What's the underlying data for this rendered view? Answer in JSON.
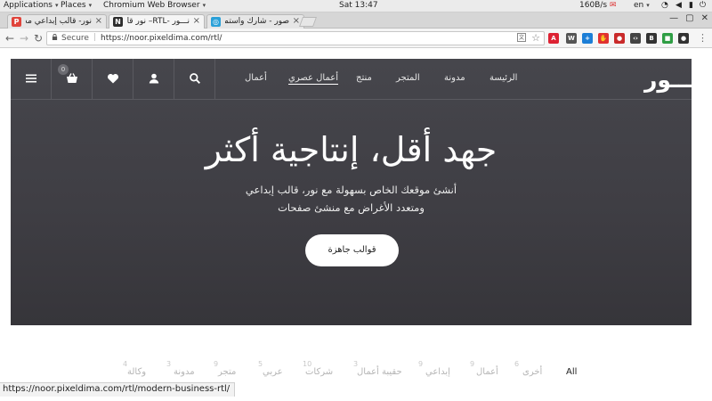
{
  "os": {
    "applications": "Applications",
    "places": "Places",
    "browser": "Chromium Web Browser",
    "clock": "Sat 13:47",
    "netspeed": "160B/s",
    "lang": "en"
  },
  "tabs": [
    {
      "title": "نور- قالب إبداعي مد",
      "favicon_letter": "P",
      "favicon_color": "#e0443b"
    },
    {
      "title": "نـــور -RTL– نور قا",
      "favicon_letter": "N",
      "favicon_color": "#2d2d2d"
    },
    {
      "title": "صور - شارك واستما",
      "favicon_letter": "",
      "favicon_color": "#2aa0d8"
    }
  ],
  "address": {
    "secure_label": "Secure",
    "url": "https://noor.pixeldima.com/rtl/"
  },
  "site": {
    "logo": "نـــور",
    "menu": [
      {
        "label": "الرئيسة"
      },
      {
        "label": "مدونة"
      },
      {
        "label": "المتجر"
      },
      {
        "label": "منتج"
      },
      {
        "label": "أعمال عصري"
      },
      {
        "label": "أعمال"
      }
    ],
    "cart_count": "0",
    "headline": "جهد أقل، إنتاجية أكثر",
    "sub1": "أنشئ موقعك الخاص بسهولة مع نور، قالب إبداعي",
    "sub2": "ومتعدد الأغراض مع منشئ صفحات",
    "cta": "قوالب جاهزة",
    "accent_color": "#3f3e44"
  },
  "filters": [
    {
      "label": "All",
      "count": ""
    },
    {
      "label": "أخرى",
      "count": "6"
    },
    {
      "label": "أعمال",
      "count": "9"
    },
    {
      "label": "إبداعي",
      "count": "9"
    },
    {
      "label": "حقيبة أعمال",
      "count": "3"
    },
    {
      "label": "شركات",
      "count": "10"
    },
    {
      "label": "عربي",
      "count": "5"
    },
    {
      "label": "متجر",
      "count": "9"
    },
    {
      "label": "مدونة",
      "count": "3"
    },
    {
      "label": "وكالة",
      "count": "4"
    }
  ],
  "status_url": "https://noor.pixeldima.com/rtl/modern-business-rtl/"
}
